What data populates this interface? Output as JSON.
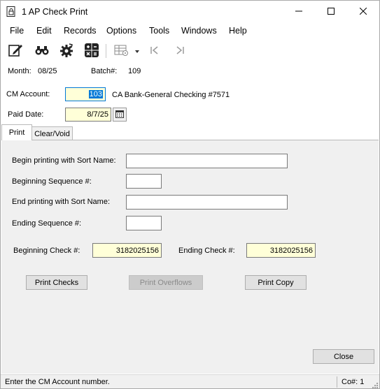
{
  "window": {
    "title": "1 AP Check Print",
    "app_icon": "document-lock-icon",
    "controls": [
      "minimize-icon",
      "maximize-icon",
      "close-icon"
    ]
  },
  "menu": {
    "items": [
      "File",
      "Edit",
      "Records",
      "Options",
      "Tools",
      "Windows",
      "Help"
    ]
  },
  "toolbar": {
    "icons": [
      "edit-checklist-icon",
      "binoculars-icon",
      "settings-gear-icon",
      "calculator-icon",
      "grid-options-icon",
      "dropdown-arrow-icon",
      "first-record-icon",
      "last-record-icon"
    ]
  },
  "header": {
    "month_label": "Month:",
    "month_value": "08/25",
    "batch_label": "Batch#:",
    "batch_value": "109"
  },
  "form": {
    "cm_account_label": "CM Account:",
    "cm_account_value": "103",
    "cm_account_desc": "CA Bank-General Checking #7571",
    "paid_date_label": "Paid Date:",
    "paid_date_value": "8/7/25"
  },
  "tabs": [
    {
      "label": "Print",
      "active": true
    },
    {
      "label": "Clear/Void",
      "active": false
    }
  ],
  "print_tab": {
    "begin_sort_label": "Begin printing with Sort Name:",
    "begin_sort_value": "",
    "begin_seq_label": "Beginning Sequence #:",
    "begin_seq_value": "",
    "end_sort_label": "End printing with Sort Name:",
    "end_sort_value": "",
    "end_seq_label": "Ending Sequence #:",
    "end_seq_value": "",
    "begin_check_label": "Beginning Check #:",
    "begin_check_value": "3182025156",
    "end_check_label": "Ending Check #:",
    "end_check_value": "3182025156",
    "print_checks_label": "Print Checks",
    "print_overflows_label": "Print Overflows",
    "print_copy_label": "Print Copy"
  },
  "close_label": "Close",
  "status": {
    "message": "Enter the CM Account number.",
    "company": "Co#: 1"
  },
  "colors": {
    "field_highlight": "#ffffd8",
    "selection": "#0078d7",
    "panel_bg": "#f0f0f0"
  }
}
